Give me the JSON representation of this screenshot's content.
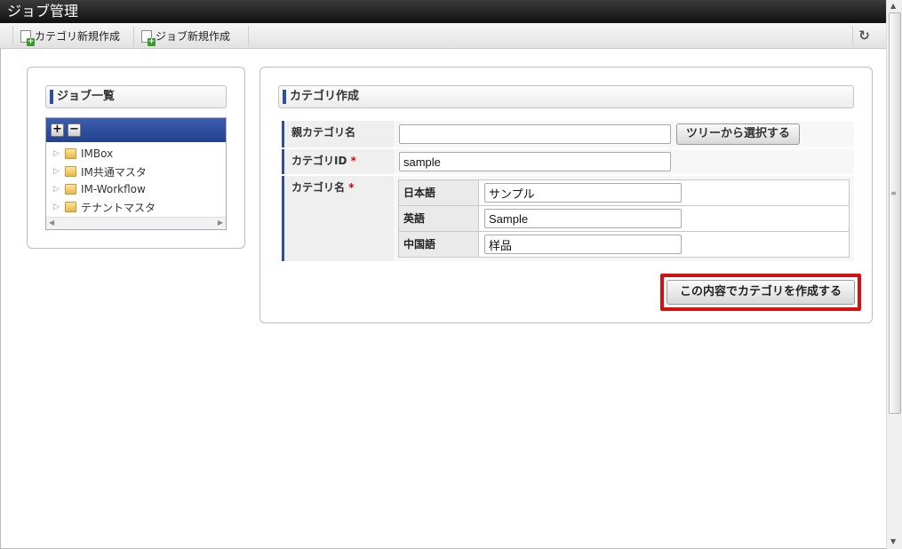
{
  "app": {
    "title": "ジョブ管理"
  },
  "toolbar": {
    "new_category_label": "カテゴリ新規作成",
    "new_job_label": "ジョブ新規作成"
  },
  "left": {
    "heading": "ジョブ一覧",
    "tree": [
      {
        "label": "IMBox"
      },
      {
        "label": "IM共通マスタ"
      },
      {
        "label": "IM-Workflow"
      },
      {
        "label": "テナントマスタ"
      }
    ]
  },
  "form": {
    "heading": "カテゴリ作成",
    "parent_label": "親カテゴリ名",
    "parent_value": "",
    "select_tree_label": "ツリーから選択する",
    "id_label": "カテゴリID",
    "id_value": "sample",
    "name_label": "カテゴリ名",
    "required_mark": "*",
    "names": [
      {
        "lang": "日本語",
        "value": "サンプル"
      },
      {
        "lang": "英語",
        "value": "Sample"
      },
      {
        "lang": "中国語",
        "value": "样品"
      }
    ],
    "submit_label": "この内容でカテゴリを作成する"
  },
  "colors": {
    "accent": "#2f4f9a",
    "highlight": "#d61010",
    "titlebar": "#1a1a1a"
  }
}
